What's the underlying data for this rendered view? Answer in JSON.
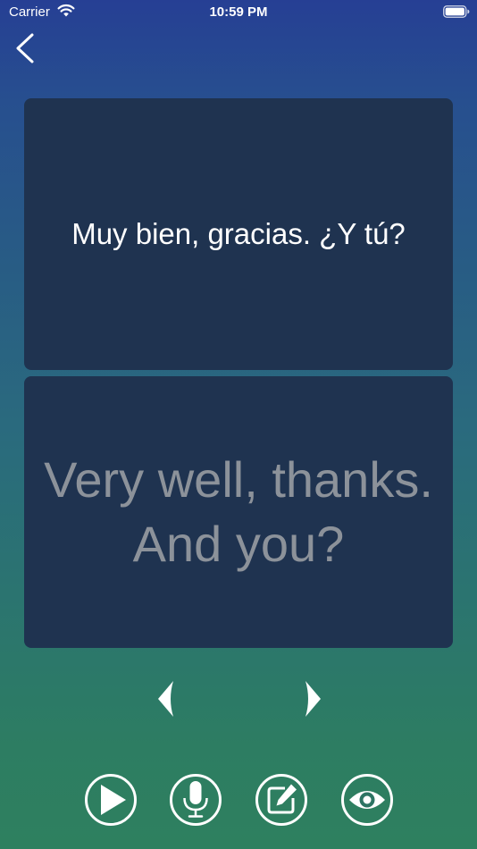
{
  "status_bar": {
    "carrier": "Carrier",
    "time": "10:59 PM"
  },
  "card": {
    "spanish": "Muy bien, gracias. ¿Y tú?",
    "english_line1": "Very well, thanks.",
    "english_line2": "And you?"
  },
  "icons": {
    "back": "chevron-left-icon",
    "prev": "triangle-left-icon",
    "next": "triangle-right-icon",
    "play": "play-icon",
    "mic": "microphone-icon",
    "edit": "edit-icon",
    "eye": "eye-icon"
  },
  "colors": {
    "gradient_top": "#263f94",
    "gradient_bottom": "#2e805f",
    "card_background": "#1f3350",
    "spanish_text": "#ffffff",
    "english_text": "#8c929a"
  }
}
